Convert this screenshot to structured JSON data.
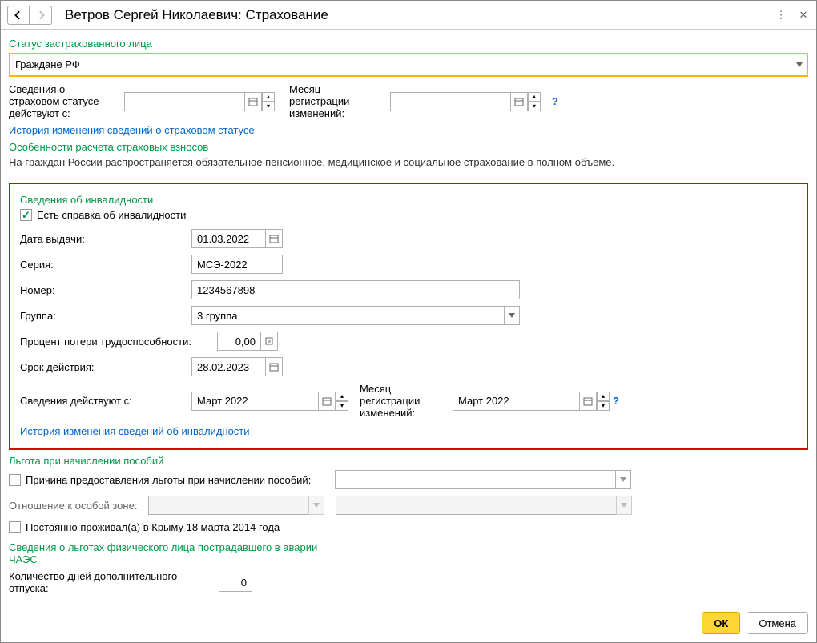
{
  "header": {
    "title": "Ветров Сергей Николаевич: Страхование"
  },
  "status_section": {
    "label": "Статус застрахованного лица",
    "value": "Граждане РФ",
    "from_label": "Сведения о страховом статусе действуют с:",
    "from_value": "",
    "month_label": "Месяц регистрации изменений:",
    "month_value": "",
    "history_link": "История изменения сведений о страховом статусе",
    "features_label": "Особенности расчета страховых взносов",
    "features_text": "На граждан России распространяется обязательное пенсионное, медицинское и социальное страхование в полном объеме."
  },
  "disability": {
    "label": "Сведения об инвалидности",
    "has_cert_label": "Есть справка об инвалидности",
    "has_cert": true,
    "issue_date_label": "Дата выдачи:",
    "issue_date": "01.03.2022",
    "series_label": "Серия:",
    "series": "МСЭ-2022",
    "number_label": "Номер:",
    "number": "1234567898",
    "group_label": "Группа:",
    "group": "3 группа",
    "percent_label": "Процент потери трудоспособности:",
    "percent": "0,00",
    "valid_until_label": "Срок действия:",
    "valid_until": "28.02.2023",
    "effective_from_label": "Сведения действуют с:",
    "effective_from": "Март 2022",
    "reg_month_label": "Месяц регистрации изменений:",
    "reg_month": "Март 2022",
    "history_link": "История изменения сведений об инвалидности"
  },
  "benefit": {
    "label": "Льгота при начислении пособий",
    "reason_label": "Причина предоставления льготы при начислении пособий:",
    "zone_label": "Отношение к особой зоне:",
    "crimea_label": "Постоянно проживал(а) в Крыму 18 марта 2014 года",
    "chaes_label": "Сведения о льготах физического лица пострадавшего в аварии ЧАЭС",
    "days_label": "Количество дней дополнительного отпуска:",
    "days_value": "0"
  },
  "buttons": {
    "ok": "ОК",
    "cancel": "Отмена"
  }
}
